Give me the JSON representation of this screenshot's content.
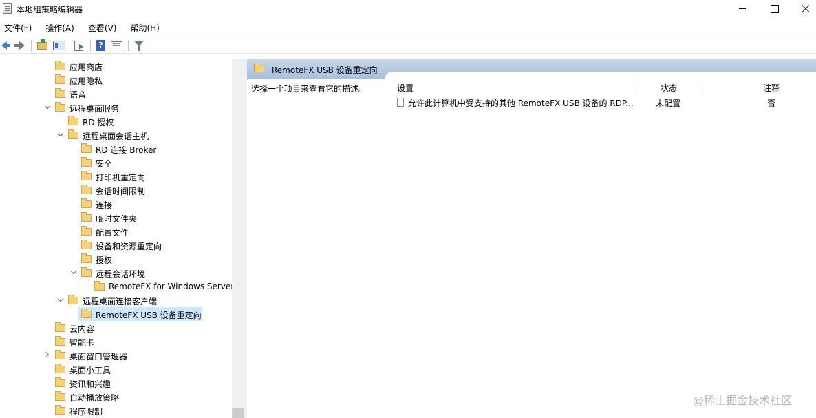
{
  "window": {
    "title": "本地组策略编辑器"
  },
  "menu": {
    "items": [
      "文件(F)",
      "操作(A)",
      "查看(V)",
      "帮助(H)"
    ]
  },
  "toolbar": {
    "icons": [
      "back-arrow-icon",
      "forward-arrow-icon",
      "up-folder-icon",
      "show-hide-tree-icon",
      "export-list-icon",
      "help-icon",
      "view-icon",
      "filter-icon"
    ]
  },
  "tree": {
    "nodes": [
      {
        "label": "应用商店",
        "expander": "none"
      },
      {
        "label": "应用隐私",
        "expander": "none"
      },
      {
        "label": "语音",
        "expander": "none"
      },
      {
        "label": "远程桌面服务",
        "expander": "open"
      },
      {
        "label": "RD 授权",
        "expander": "none"
      },
      {
        "label": "远程桌面会话主机",
        "expander": "open"
      },
      {
        "label": "RD 连接 Broker",
        "expander": "none"
      },
      {
        "label": "安全",
        "expander": "none"
      },
      {
        "label": "打印机重定向",
        "expander": "none"
      },
      {
        "label": "会话时间限制",
        "expander": "none"
      },
      {
        "label": "连接",
        "expander": "none"
      },
      {
        "label": "临时文件夹",
        "expander": "none"
      },
      {
        "label": "配置文件",
        "expander": "none"
      },
      {
        "label": "设备和资源重定向",
        "expander": "none"
      },
      {
        "label": "授权",
        "expander": "none"
      },
      {
        "label": "远程会话环境",
        "expander": "open"
      },
      {
        "label": "RemoteFX for Windows Server",
        "expander": "none"
      },
      {
        "label": "远程桌面连接客户端",
        "expander": "open"
      },
      {
        "label": "RemoteFX USB 设备重定向",
        "expander": "none",
        "selected": true
      },
      {
        "label": "云内容",
        "expander": "none"
      },
      {
        "label": "智能卡",
        "expander": "none"
      },
      {
        "label": "桌面窗口管理器",
        "expander": "closed"
      },
      {
        "label": "桌面小工具",
        "expander": "none"
      },
      {
        "label": "资讯和兴趣",
        "expander": "none"
      },
      {
        "label": "自动播放策略",
        "expander": "none"
      },
      {
        "label": "程序限制",
        "expander": "none"
      }
    ]
  },
  "details": {
    "header_title": "RemoteFX USB 设备重定向",
    "description": "选择一个项目来查看它的描述。",
    "columns": {
      "setting": "设置",
      "state": "状态",
      "comment": "注释"
    },
    "rows": [
      {
        "setting": "允许此计算机中受支持的其他 RemoteFX USB 设备的 RDP...",
        "state": "未配置",
        "comment": "否"
      }
    ]
  },
  "watermark": "@稀土掘金技术社区",
  "colors": {
    "selection": "#cce8ff",
    "header_band": "#b4c8e2",
    "folder": "#f5d178"
  }
}
